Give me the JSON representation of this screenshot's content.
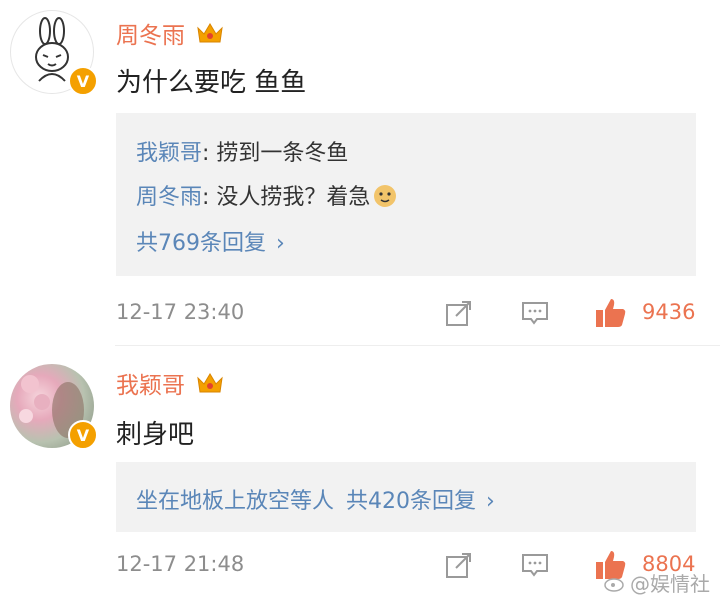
{
  "comments": [
    {
      "username": "周冬雨",
      "text": "为什么要吃 鱼鱼",
      "replies": [
        {
          "name": "我颖哥",
          "text": ": 捞到一条冬鱼"
        },
        {
          "name": "周冬雨",
          "text": ": 没人捞我？着急"
        }
      ],
      "more": "共769条回复",
      "time": "12-17 23:40",
      "likes": "9436"
    },
    {
      "username": "我颖哥",
      "text": "刺身吧",
      "reply_inline": "坐在地板上放空等人",
      "more": "共420条回复",
      "time": "12-17 21:48",
      "likes": "8804"
    }
  ],
  "icons": {
    "verified": "V",
    "share": "share-icon",
    "comment": "comment-icon",
    "like": "thumbs-up-icon",
    "crown": "crown-icon"
  },
  "watermark": "@娱情社",
  "colors": {
    "accent": "#eb7350",
    "link": "#5a86b8",
    "gold": "#f4a000"
  }
}
